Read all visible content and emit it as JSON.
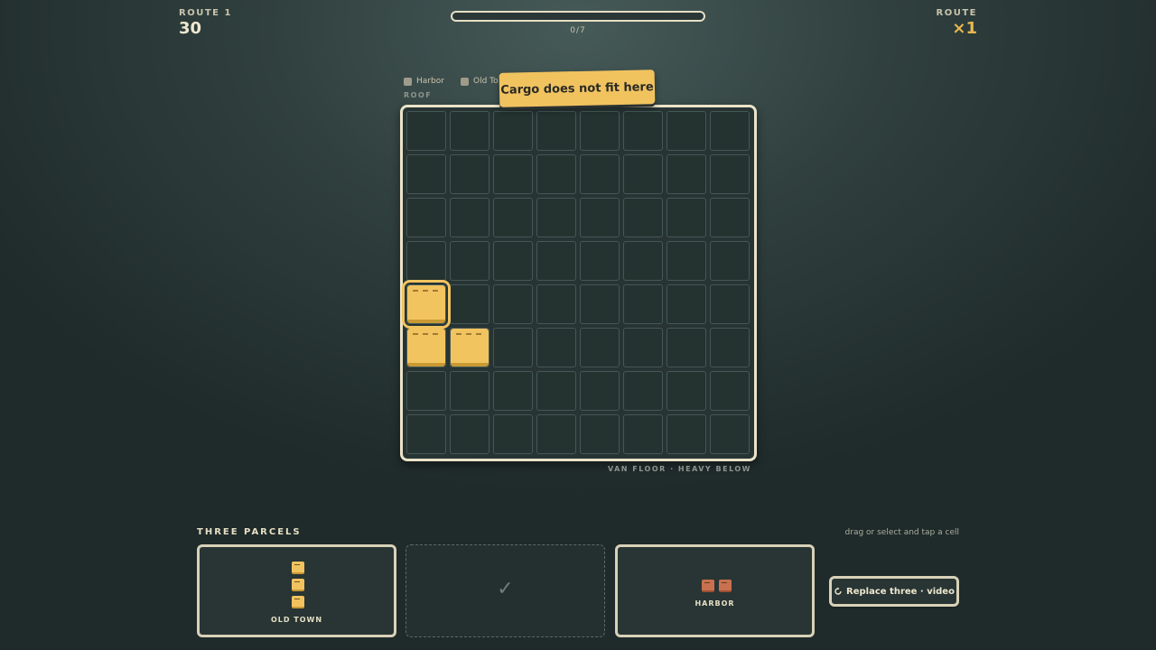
{
  "hud": {
    "left_label": "ROUTE 1",
    "left_value": "30",
    "right_label": "ROUTE",
    "right_value": "×1"
  },
  "progress": {
    "text": "0/7",
    "fraction": 0
  },
  "legend": [
    {
      "label": "Harbor"
    },
    {
      "label": "Old To"
    }
  ],
  "board": {
    "roof_label": "ROOF",
    "floor_label": "VAN FLOOR · HEAVY BELOW",
    "rows": 8,
    "cols": 8,
    "filled": [
      {
        "row": 4,
        "col": 0,
        "selected": true
      },
      {
        "row": 5,
        "col": 0,
        "selected": false
      },
      {
        "row": 5,
        "col": 1,
        "selected": false
      }
    ],
    "colors": {
      "crate": "#f2c460",
      "grid_border": "#455856"
    }
  },
  "toast": "Cargo does not fit here",
  "tray": {
    "title": "THREE PARCELS",
    "hint": "drag or select and tap a cell",
    "cards": [
      {
        "label": "OLD TOWN",
        "shape": "vertical-3",
        "color": "#f1c35f"
      },
      {
        "label": "",
        "placed": true,
        "check": "✓"
      },
      {
        "label": "HARBOR",
        "shape": "horizontal-2",
        "color": "#c9714f"
      }
    ]
  },
  "replace_button": {
    "icon": "refresh-icon",
    "label": "Replace three · video"
  }
}
